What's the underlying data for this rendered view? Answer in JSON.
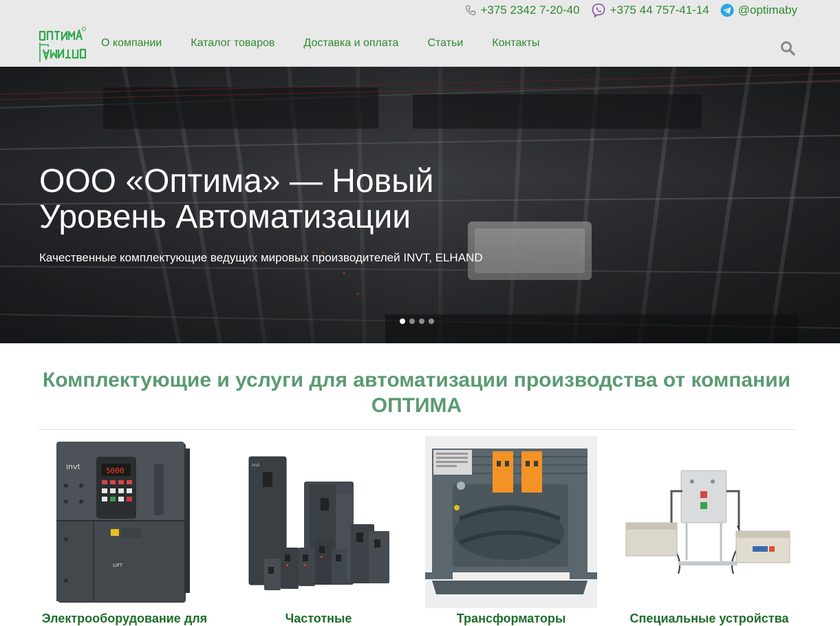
{
  "header": {
    "contacts": [
      {
        "icon": "phone-icon",
        "text": "+375 2342 7-20-40"
      },
      {
        "icon": "viber-icon",
        "text": "+375 44 757-41-14"
      },
      {
        "icon": "telegram-icon",
        "text": "@optimaby"
      }
    ],
    "logo_text_top": "ОПТИМА",
    "logo_text_bottom": "ОПТИМА",
    "nav": [
      {
        "label": "О компании"
      },
      {
        "label": "Каталог товаров"
      },
      {
        "label": "Доставка и оплата"
      },
      {
        "label": "Статьи"
      },
      {
        "label": "Контакты"
      }
    ]
  },
  "hero": {
    "title": "ООО «Оптима» — Новый Уровень Автоматизации",
    "subtitle": "Качественные комплектующие ведущих мировых производителей INVT, ELHAND",
    "slides_count": 4,
    "active_slide": 1
  },
  "section": {
    "title": "Комплектующие и услуги для автоматизации производства от компании ОПТИМА"
  },
  "products": [
    {
      "name": "Электрооборудование для",
      "brand_label": "invt",
      "panel_label": "LIFT"
    },
    {
      "name": "Частотные",
      "brand_label": "invt"
    },
    {
      "name": "Трансформаторы"
    },
    {
      "name": "Специальные устройства"
    }
  ],
  "colors": {
    "accent_green": "#2e8b2e",
    "section_title": "#5b9a73",
    "product_name": "#1f6e2a",
    "header_bg": "#e9e9e9"
  }
}
